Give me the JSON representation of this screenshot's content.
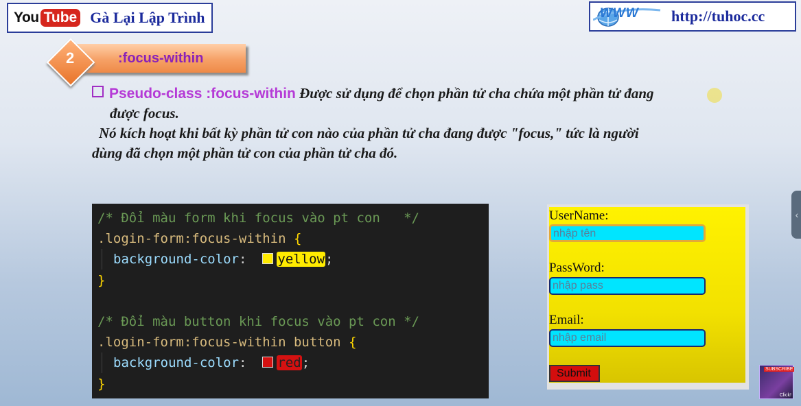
{
  "header": {
    "youtube_you": "You",
    "youtube_tube": "Tube",
    "channel_name": "Gà Lại Lập Trình",
    "www_logo": "WWW",
    "site_url": "http://tuhoc.cc"
  },
  "section": {
    "number": "2",
    "title": ":focus-within"
  },
  "description": {
    "heading": "Pseudo-class :focus-within",
    "line1_rest": "Được sử dụng để chọn phần tử cha chứa một phần tử đang",
    "line2": "được focus.",
    "line3": "Nó kích hoạt khi bất kỳ phần tử con nào của phần tử cha đang được \"focus,\" tức là người",
    "line4": "dùng đã chọn một phần tử con của phần tử cha đó."
  },
  "code": {
    "comment1": "/* Đổi màu form khi focus vào pt con   */",
    "selector1": ".login-form:focus-within",
    "prop1": "background-color",
    "value1": "yellow",
    "comment2": "/* Đổi màu button khi focus vào pt con */",
    "selector2": ".login-form:focus-within button",
    "prop2": "background-color",
    "value2": "red",
    "open_brace": "{",
    "close_brace": "}",
    "colon": ":",
    "semicolon": ";"
  },
  "form": {
    "username_label": "UserName:",
    "username_placeholder": "nhập tên",
    "password_label": "PassWord:",
    "password_placeholder": "nhập pass",
    "email_label": "Email:",
    "email_placeholder": "nhập email",
    "submit_label": "Submit"
  },
  "overlay": {
    "side_handle": "‹",
    "avatar_badge": "SUBSCRIBE",
    "avatar_click": "Click!"
  },
  "colors": {
    "yellow": "#ffeb00",
    "red": "#d41111",
    "accent_purple": "#b53ad6"
  }
}
